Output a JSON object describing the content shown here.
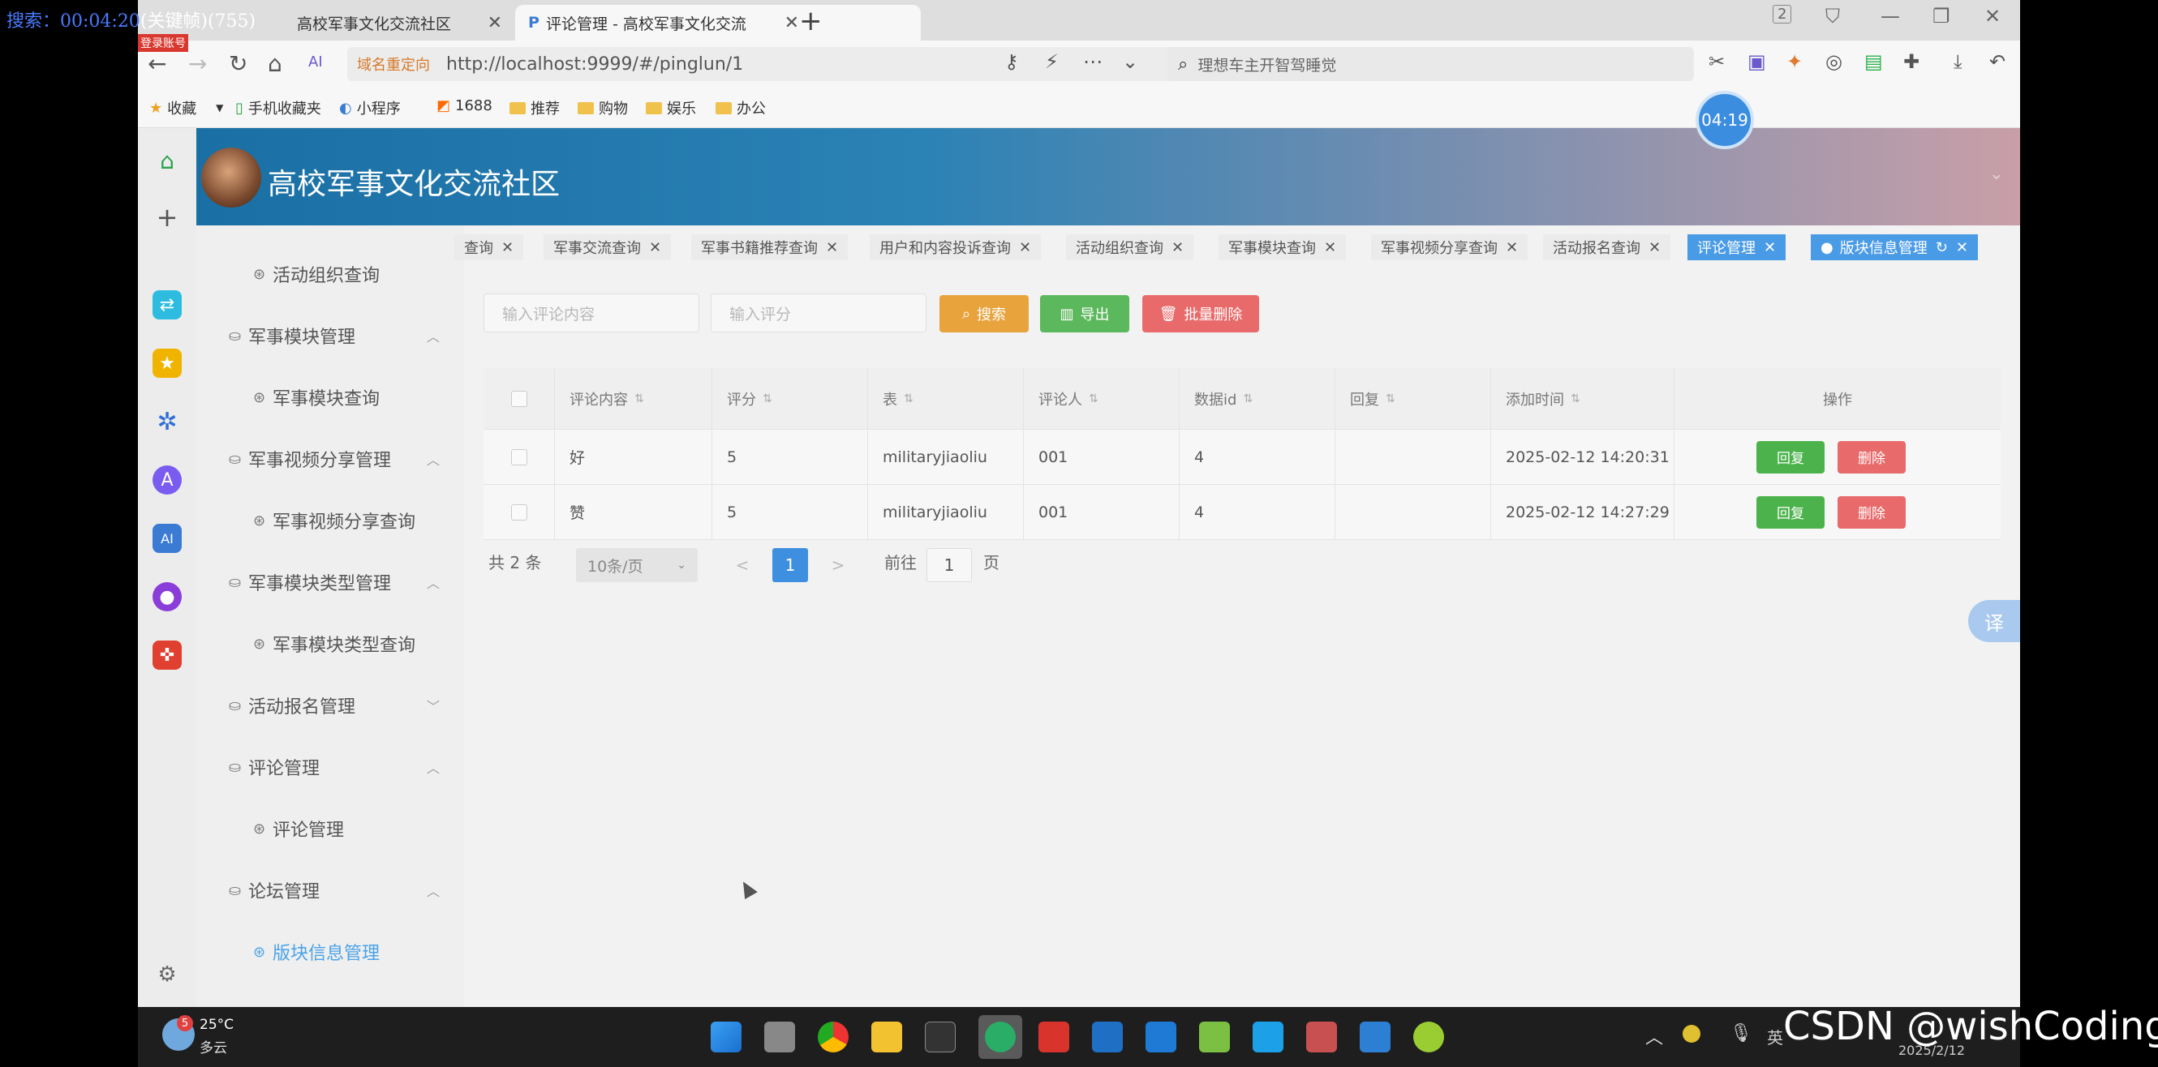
{
  "overlay": {
    "search_label": "搜索：00:04:20",
    "search_keyword": "(关键帧)(755)",
    "login_badge": "登录账号"
  },
  "browser": {
    "tabs": [
      {
        "title": "高校军事文化交流社区",
        "active": false
      },
      {
        "title": "评论管理 - 高校军事文化交流",
        "active": true
      }
    ],
    "new_tab": "+",
    "window_count": "2",
    "redirect_label": "域名重定向",
    "url": "http://localhost:9999/#/pinglun/1",
    "search_placeholder": "理想车主开智驾睡觉",
    "timer": "04:19"
  },
  "bookmarks": [
    {
      "label": "收藏",
      "icon": "star-icon"
    },
    {
      "label": "手机收藏夹",
      "icon": "phone-icon"
    },
    {
      "label": "小程序",
      "icon": "miniprogram-icon"
    },
    {
      "label": "1688",
      "icon": "1688-icon"
    },
    {
      "label": "推荐",
      "icon": "folder-icon"
    },
    {
      "label": "购物",
      "icon": "folder-icon"
    },
    {
      "label": "娱乐",
      "icon": "folder-icon"
    },
    {
      "label": "办公",
      "icon": "folder-icon"
    }
  ],
  "site": {
    "title": "高校军事文化交流社区"
  },
  "sidebar": {
    "items": [
      {
        "label": "活动组织查询",
        "level": "sub",
        "active": false
      },
      {
        "label": "军事模块管理",
        "level": "group",
        "active": false,
        "chev": "^"
      },
      {
        "label": "军事模块查询",
        "level": "sub",
        "active": false
      },
      {
        "label": "军事视频分享管理",
        "level": "group",
        "active": false,
        "chev": "^"
      },
      {
        "label": "军事视频分享查询",
        "level": "sub",
        "active": false
      },
      {
        "label": "军事模块类型管理",
        "level": "group",
        "active": false,
        "chev": "^"
      },
      {
        "label": "军事模块类型查询",
        "level": "sub",
        "active": false
      },
      {
        "label": "活动报名管理",
        "level": "group",
        "active": false,
        "chev": "v"
      },
      {
        "label": "评论管理",
        "level": "group",
        "active": false,
        "chev": "^"
      },
      {
        "label": "评论管理",
        "level": "sub",
        "active": false
      },
      {
        "label": "论坛管理",
        "level": "group",
        "active": false,
        "chev": "^"
      },
      {
        "label": "版块信息管理",
        "level": "sub",
        "active": true
      }
    ]
  },
  "tags": [
    {
      "label": "查询",
      "active": false
    },
    {
      "label": "军事交流查询",
      "active": false
    },
    {
      "label": "军事书籍推荐查询",
      "active": false
    },
    {
      "label": "用户和内容投诉查询",
      "active": false
    },
    {
      "label": "活动组织查询",
      "active": false
    },
    {
      "label": "军事模块查询",
      "active": false
    },
    {
      "label": "军事视频分享查询",
      "active": false
    },
    {
      "label": "活动报名查询",
      "active": false
    },
    {
      "label": "评论管理",
      "active": true
    },
    {
      "label": "版块信息管理",
      "active": true
    }
  ],
  "filters": {
    "content_placeholder": "输入评论内容",
    "rating_placeholder": "输入评分",
    "search_btn": "搜索",
    "export_btn": "导出",
    "batch_delete_btn": "批量删除"
  },
  "table": {
    "headers": [
      "评论内容",
      "评分",
      "表",
      "评论人",
      "数据id",
      "回复",
      "添加时间",
      "操作"
    ],
    "rows": [
      {
        "content": "好",
        "rating": "5",
        "table": "militaryjiaoliu",
        "user": "001",
        "data_id": "4",
        "reply": "",
        "time": "2025-02-12 14:20:31"
      },
      {
        "content": "赞",
        "rating": "5",
        "table": "militaryjiaoliu",
        "user": "001",
        "data_id": "4",
        "reply": "",
        "time": "2025-02-12 14:27:29"
      }
    ],
    "reply_btn": "回复",
    "delete_btn": "删除"
  },
  "pagination": {
    "total": "共 2 条",
    "page_size": "10条/页",
    "current": "1",
    "goto_prefix": "前往",
    "goto_value": "1",
    "goto_suffix": "页",
    "prev": "<",
    "next": ">"
  },
  "translate": "译",
  "taskbar": {
    "temp": "25°C",
    "weather": "多云",
    "weather_badge": "5",
    "lang": "英",
    "date": "2025/2/12"
  },
  "watermark": "CSDN @wishCoding",
  "colors": {
    "primary": "#4a9be6",
    "search_btn": "#e8a33d",
    "export_btn": "#5cb85c",
    "delete_btn": "#e86a6a",
    "reply_btn": "#4cb34c"
  }
}
